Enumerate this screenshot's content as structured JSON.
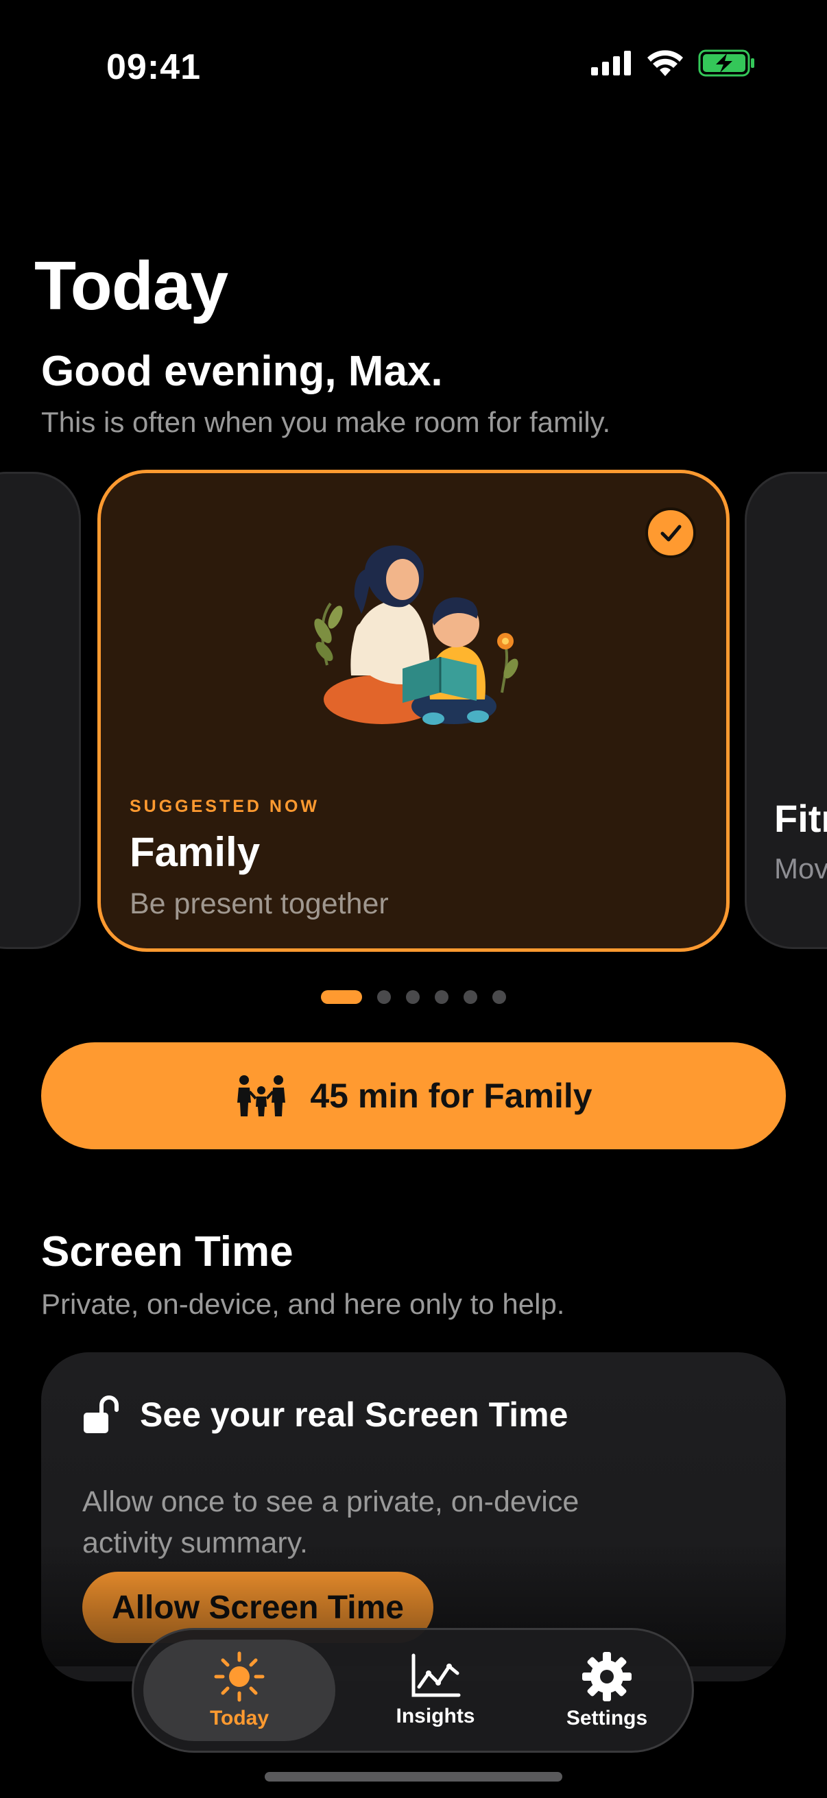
{
  "status_bar": {
    "time": "09:41",
    "icons": [
      "cellular-signal-icon",
      "wifi-icon",
      "battery-charging-icon"
    ],
    "battery_color": "#34c759"
  },
  "page": {
    "title": "Today"
  },
  "greeting": {
    "title": "Good evening, Max.",
    "subtitle": "This is often when you make room for family."
  },
  "carousel": {
    "active_card": {
      "kicker": "SUGGESTED NOW",
      "title": "Family",
      "subtitle": "Be present together",
      "selected": true,
      "illustration": "parent-reading-to-child-illustration"
    },
    "next_card": {
      "title": "Fitness",
      "subtitle": "Move"
    },
    "page_count": 6,
    "active_page": 1
  },
  "cta": {
    "label": "45 min for Family",
    "icon": "family-icon"
  },
  "screen_time": {
    "heading": "Screen Time",
    "subtitle": "Private, on-device, and here only to help.",
    "card": {
      "icon": "lock-open-icon",
      "title": "See your real Screen Time",
      "body": "Allow once to see a private, on-device activity summary.",
      "button_label": "Allow Screen Time"
    }
  },
  "tab_bar": {
    "tabs": [
      {
        "label": "Today",
        "icon": "sun-icon",
        "selected": true
      },
      {
        "label": "Insights",
        "icon": "chart-line-icon",
        "selected": false
      },
      {
        "label": "Settings",
        "icon": "gear-icon",
        "selected": false
      }
    ]
  },
  "colors": {
    "accent": "#ff9a30",
    "background": "#000000",
    "card_background": "#2c1a0b",
    "secondary_text": "#9a9a9a"
  }
}
